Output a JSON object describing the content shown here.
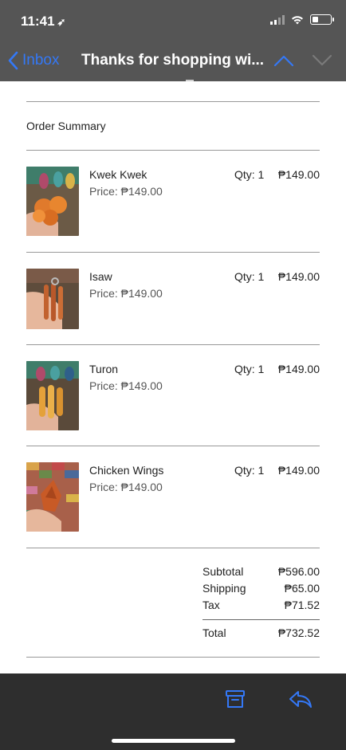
{
  "status": {
    "time": "11:41",
    "location_icon": "location-arrow-icon"
  },
  "nav": {
    "back_label": "Inbox",
    "title": "Thanks for shopping wi..."
  },
  "order": {
    "heading": "Order Summary",
    "items": [
      {
        "name": "Kwek Kwek",
        "price": "Price: ₱149.00",
        "qty": "Qty: 1",
        "total": "₱149.00",
        "thumb_color": "#e07a2c"
      },
      {
        "name": "Isaw",
        "price": "Price: ₱149.00",
        "qty": "Qty: 1",
        "total": "₱149.00",
        "thumb_color": "#c2622f"
      },
      {
        "name": "Turon",
        "price": "Price: ₱149.00",
        "qty": "Qty: 1",
        "total": "₱149.00",
        "thumb_color": "#e4a13a"
      },
      {
        "name": "Chicken Wings",
        "price": "Price: ₱149.00",
        "qty": "Qty: 1",
        "total": "₱149.00",
        "thumb_color": "#c85a26"
      }
    ],
    "totals": {
      "subtotal_label": "Subtotal",
      "subtotal": "₱596.00",
      "shipping_label": "Shipping",
      "shipping": "₱65.00",
      "tax_label": "Tax",
      "tax": "₱71.52",
      "total_label": "Total",
      "total": "₱732.52"
    }
  },
  "colors": {
    "accent": "#3478f6",
    "topbar": "#555555",
    "toolbar": "#2e2e2e"
  }
}
